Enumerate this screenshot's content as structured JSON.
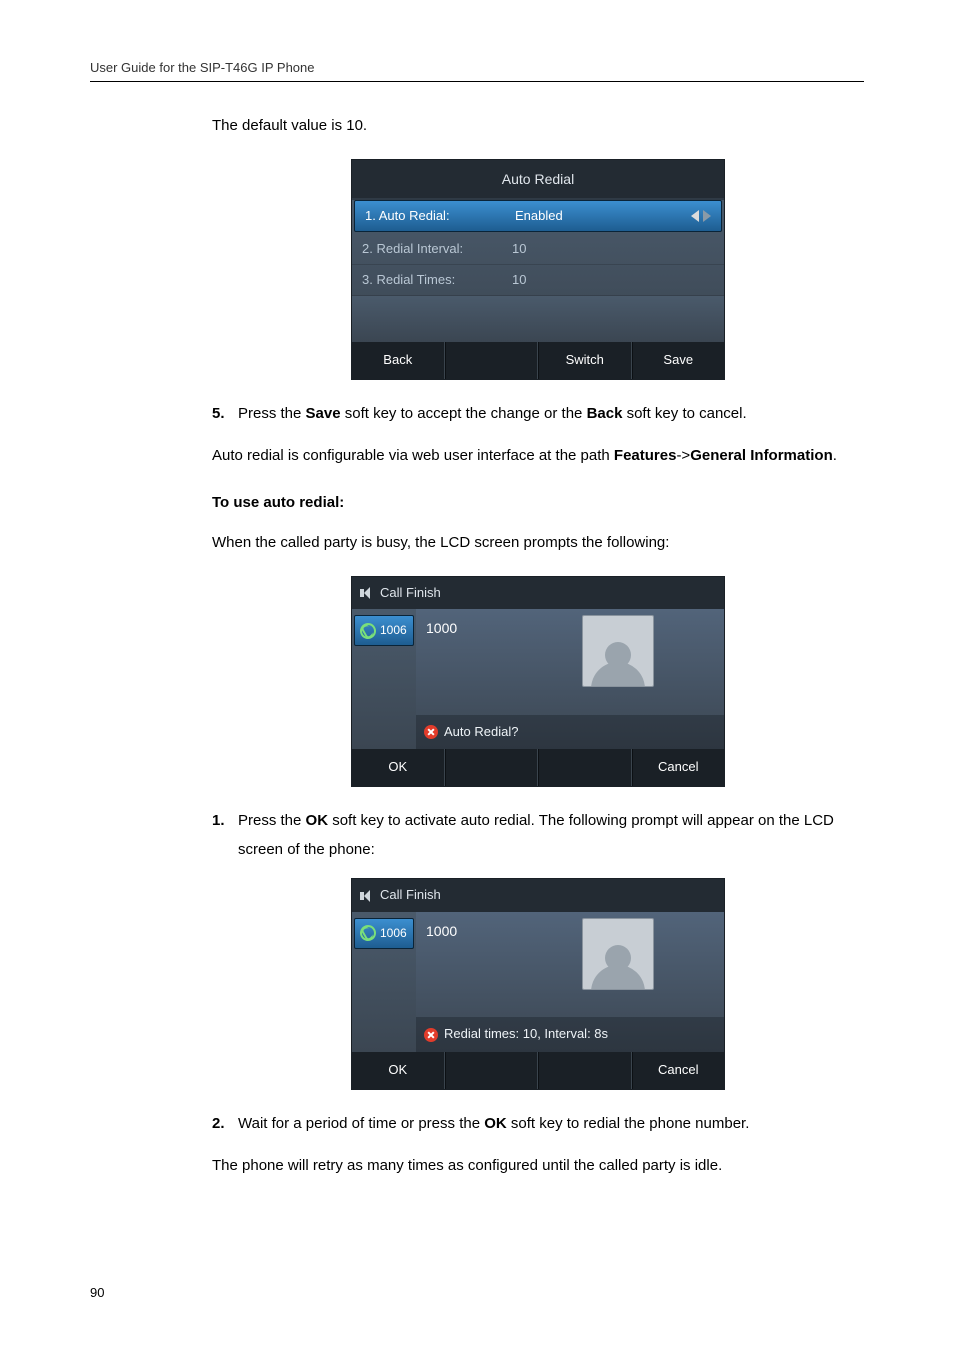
{
  "running_header": "User Guide for the SIP-T46G IP Phone",
  "intro_para": "The default value is 10.",
  "screen1": {
    "title": "Auto Redial",
    "row1_label": "1. Auto Redial:",
    "row1_value": "Enabled",
    "row2_label": "2. Redial Interval:",
    "row2_value": "10",
    "row3_label": "3. Redial Times:",
    "row3_value": "10",
    "sk_back": "Back",
    "sk_switch": "Switch",
    "sk_save": "Save"
  },
  "step5_num": "5.",
  "step5_a": "Press the ",
  "step5_b": "Save",
  "step5_c": " soft key to accept the change or the ",
  "step5_d": "Back",
  "step5_e": " soft key to cancel.",
  "path_a": "Auto redial is configurable via web user interface at the path ",
  "path_b": "Features",
  "path_c": "->",
  "path_d": "General Information",
  "path_e": ".",
  "heading_use": "To use auto redial:",
  "busy_prompt": "When the called party is busy, the LCD screen prompts the following:",
  "screen2": {
    "top_title": "Call Finish",
    "line_label": "1006",
    "caller": "1000",
    "prompt": "Auto Redial?",
    "sk_ok": "OK",
    "sk_cancel": "Cancel"
  },
  "step1_num": "1.",
  "step1_a": "Press the ",
  "step1_b": "OK",
  "step1_c": " soft key to activate auto redial. The following prompt will appear on the LCD screen of the phone:",
  "screen3": {
    "top_title": "Call Finish",
    "line_label": "1006",
    "caller": "1000",
    "prompt": "Redial times: 10, Interval: 8s",
    "sk_ok": "OK",
    "sk_cancel": "Cancel"
  },
  "step2_num": "2.",
  "step2_a": "Wait for a period of time or press the ",
  "step2_b": "OK",
  "step2_c": " soft key to redial the phone number.",
  "retry_para": "The phone will retry as many times as configured until the called party is idle.",
  "page_number": "90"
}
